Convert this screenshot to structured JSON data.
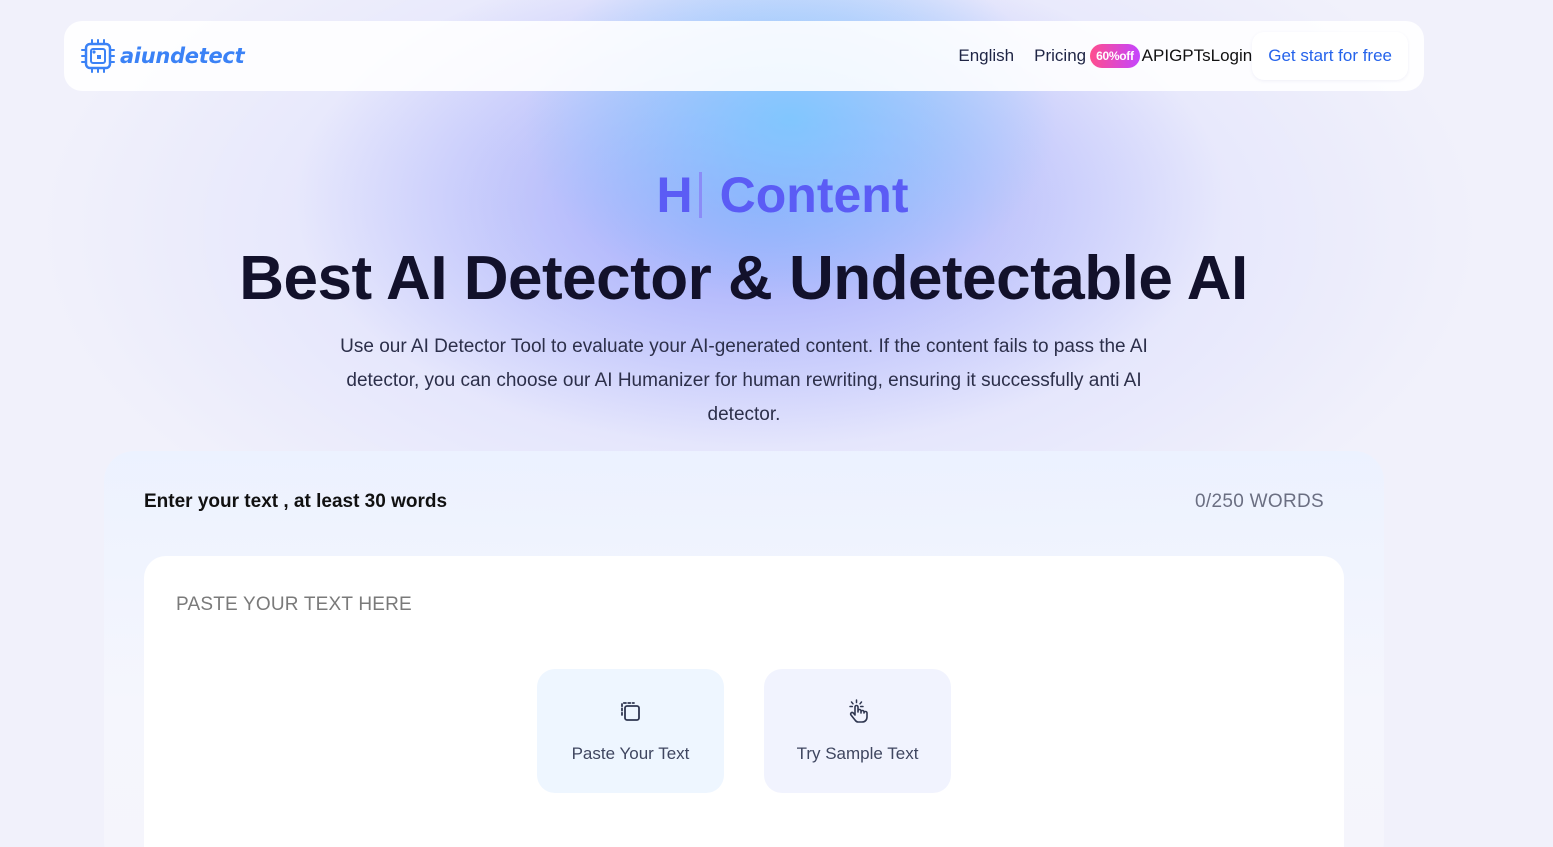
{
  "brand": {
    "name": "aiundetect",
    "accent": "#3b82f6"
  },
  "nav": {
    "language": "English",
    "pricing": "Pricing",
    "pricing_badge": "60%off",
    "api": "API",
    "gpts": "GPTs",
    "login": "Login",
    "cta": "Get start for free"
  },
  "hero": {
    "typing_text": "H",
    "typing_suffix": "Content",
    "title": "Best AI Detector & Undetectable AI",
    "description": "Use our AI Detector Tool to evaluate your AI-generated content. If the content fails to pass the AI detector, you can choose our AI Humanizer for human rewriting, ensuring it successfully anti AI detector."
  },
  "editor": {
    "label": "Enter your text , at least 30 words",
    "word_count": "0/250 WORDS",
    "placeholder": "PASTE YOUR TEXT HERE",
    "paste_button": "Paste Your Text",
    "sample_button": "Try Sample Text"
  },
  "icons": {
    "logo": "chip-logo-icon",
    "paste": "clipboard-paste-icon",
    "sample": "pointer-hand-icon"
  }
}
